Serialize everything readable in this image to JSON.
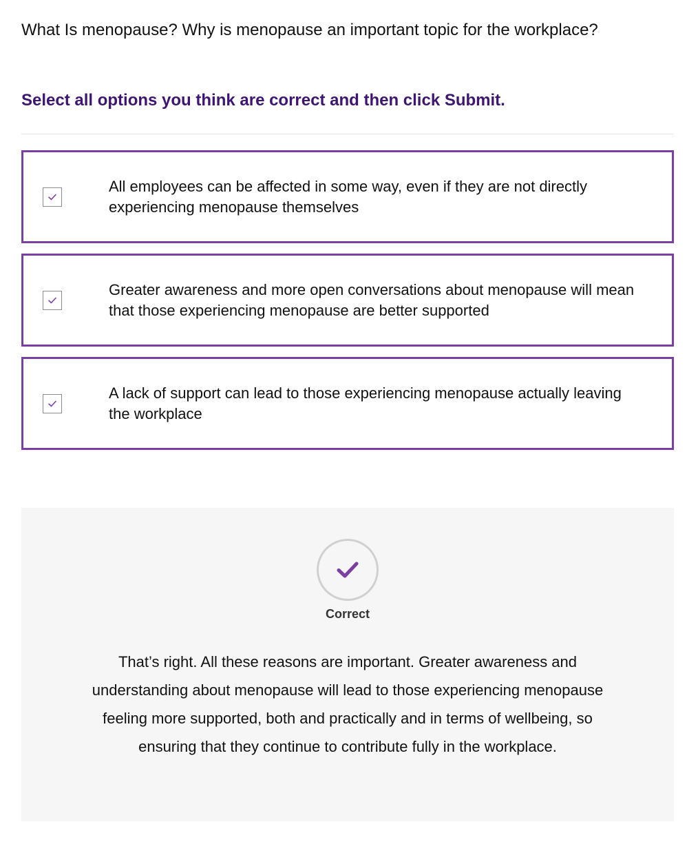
{
  "question": "What Is menopause? Why is menopause an important topic for the workplace?",
  "instruction": "Select all options you think are correct and then click Submit.",
  "colors": {
    "accent": "#7b3fa3",
    "instruction": "#3d1670",
    "feedback_background": "#f6f6f6"
  },
  "options": [
    {
      "label": "All employees can be affected in some way, even if they are not directly experiencing menopause themselves",
      "checked": true
    },
    {
      "label": "Greater awareness and more open conversations about menopause will mean that those experiencing menopause are better supported",
      "checked": true
    },
    {
      "label": "A lack of support can lead to those experiencing menopause actually leaving the workplace",
      "checked": true
    }
  ],
  "feedback": {
    "icon": "check-icon",
    "status": "Correct",
    "text": "That’s right. All these reasons are important.  Greater awareness and understanding about menopause will lead to those experiencing menopause feeling more supported, both and practically and in terms of wellbeing, so ensuring that they continue to contribute fully in the workplace."
  }
}
